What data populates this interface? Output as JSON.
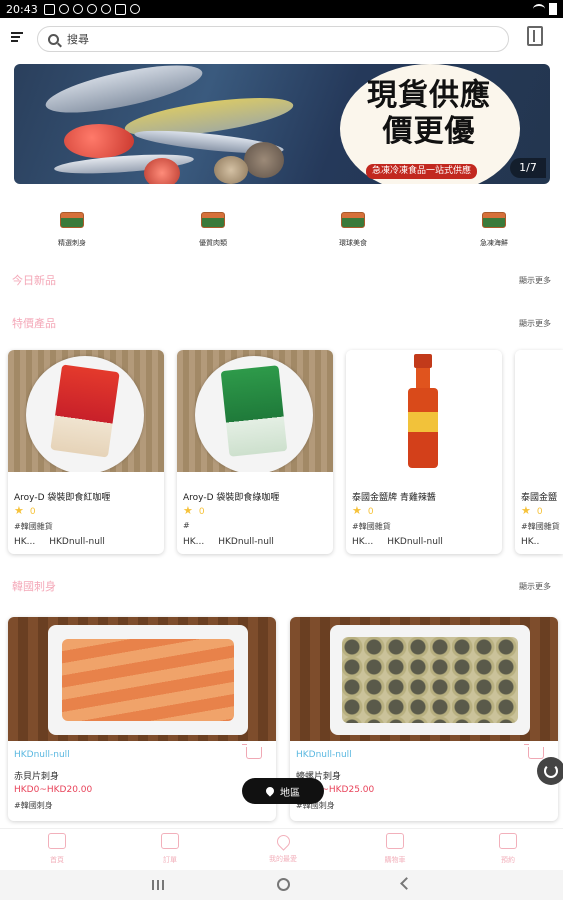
{
  "status_bar": {
    "time": "20:43"
  },
  "search": {
    "placeholder": "搜尋"
  },
  "banner": {
    "title_line1": "現貨供應",
    "title_line2": "價更優",
    "subtitle": "急凍冷凍食品一站式供應",
    "counter": "1/7"
  },
  "categories": [
    {
      "label": "精選刺身"
    },
    {
      "label": "優質肉類"
    },
    {
      "label": "環球美食"
    },
    {
      "label": "急凍海鮮"
    }
  ],
  "sections": {
    "today_new": {
      "title": "今日新品",
      "more": "顯示更多"
    },
    "featured": {
      "title": "特價產品",
      "more": "顯示更多"
    },
    "korean_sashimi": {
      "title": "韓國刺身",
      "more": "顯示更多"
    }
  },
  "products": [
    {
      "name": "Aroy-D 袋裝即食紅咖喱",
      "rating": "0",
      "tag": "#韓國雜貨",
      "price_left": "HK...",
      "price_right": "HKDnull-null"
    },
    {
      "name": "Aroy-D 袋裝即食綠咖喱",
      "rating": "0",
      "tag": "#",
      "price_left": "HK...",
      "price_right": "HKDnull-null"
    },
    {
      "name": "泰國金鹽牌 青雞辣醬",
      "rating": "0",
      "tag": "#韓國雜貨",
      "price_left": "HK...",
      "price_right": "HKDnull-null"
    },
    {
      "name": "泰國金鹽",
      "rating": "0",
      "tag": "#韓國雜貨",
      "price_left": "HK..",
      "price_right": ""
    }
  ],
  "big_products": [
    {
      "price_top": "HKDnull-null",
      "name": "赤貝片刺身",
      "price": "HKD0~HKD20.00",
      "tag": "#韓國刺身"
    },
    {
      "price_top": "HKDnull-null",
      "name": "蠔螺片刺身",
      "price": "HKD0~HKD25.00",
      "tag": "#韓國刺身"
    }
  ],
  "map_button": {
    "label": "地區"
  },
  "bottom_nav": [
    {
      "label": "首頁"
    },
    {
      "label": "訂單"
    },
    {
      "label": "我的最愛"
    },
    {
      "label": "購物車"
    },
    {
      "label": "預約"
    }
  ],
  "colors": {
    "accent_pink": "#f4a8b8",
    "price_red": "#e8435a",
    "price_blue": "#5bb8e0",
    "star": "#f6c23a"
  }
}
